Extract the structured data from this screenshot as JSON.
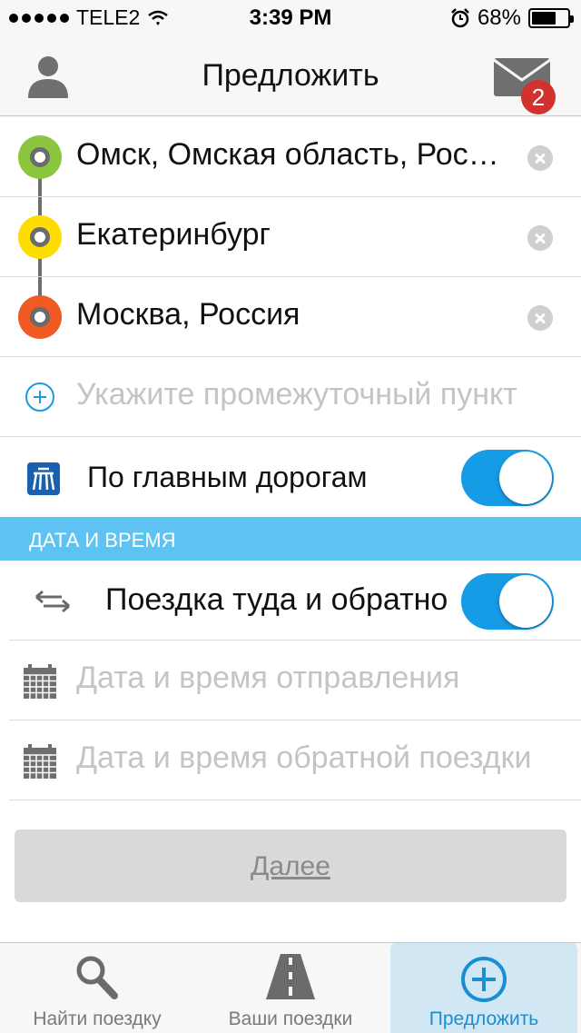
{
  "status_bar": {
    "carrier": "TELE2",
    "time": "3:39 PM",
    "battery_percent": "68%",
    "battery_level": 0.68
  },
  "nav": {
    "title": "Предложить",
    "mail_badge": "2",
    "icons": {
      "left": "person-icon",
      "right": "mail-icon"
    }
  },
  "route": {
    "stops": [
      {
        "label": "Омск, Омская область, Россия",
        "color": "#8cc63f"
      },
      {
        "label": "Екатеринбург",
        "color": "#ffdc00"
      },
      {
        "label": "Москва, Россия",
        "color": "#f15a22"
      }
    ],
    "add_stop_placeholder": "Укажите промежуточный пункт",
    "main_roads": {
      "label": "По главным дорогам",
      "enabled": true
    }
  },
  "datetime": {
    "section_title": "ДАТА И ВРЕМЯ",
    "round_trip": {
      "label": "Поездка туда и обратно",
      "enabled": true
    },
    "departure_placeholder": "Дата и время отправления",
    "return_placeholder": "Дата и время обратной поездки"
  },
  "next_button": {
    "label": "Далее",
    "disabled": true
  },
  "tabs": [
    {
      "label": "Найти поездку",
      "icon": "search-icon",
      "active": false
    },
    {
      "label": "Ваши поездки",
      "icon": "road-icon",
      "active": false
    },
    {
      "label": "Предложить",
      "icon": "add-circle-icon",
      "active": true
    }
  ],
  "colors": {
    "accent": "#169be6",
    "section_header": "#5ec3f2",
    "badge": "#d2322d"
  }
}
